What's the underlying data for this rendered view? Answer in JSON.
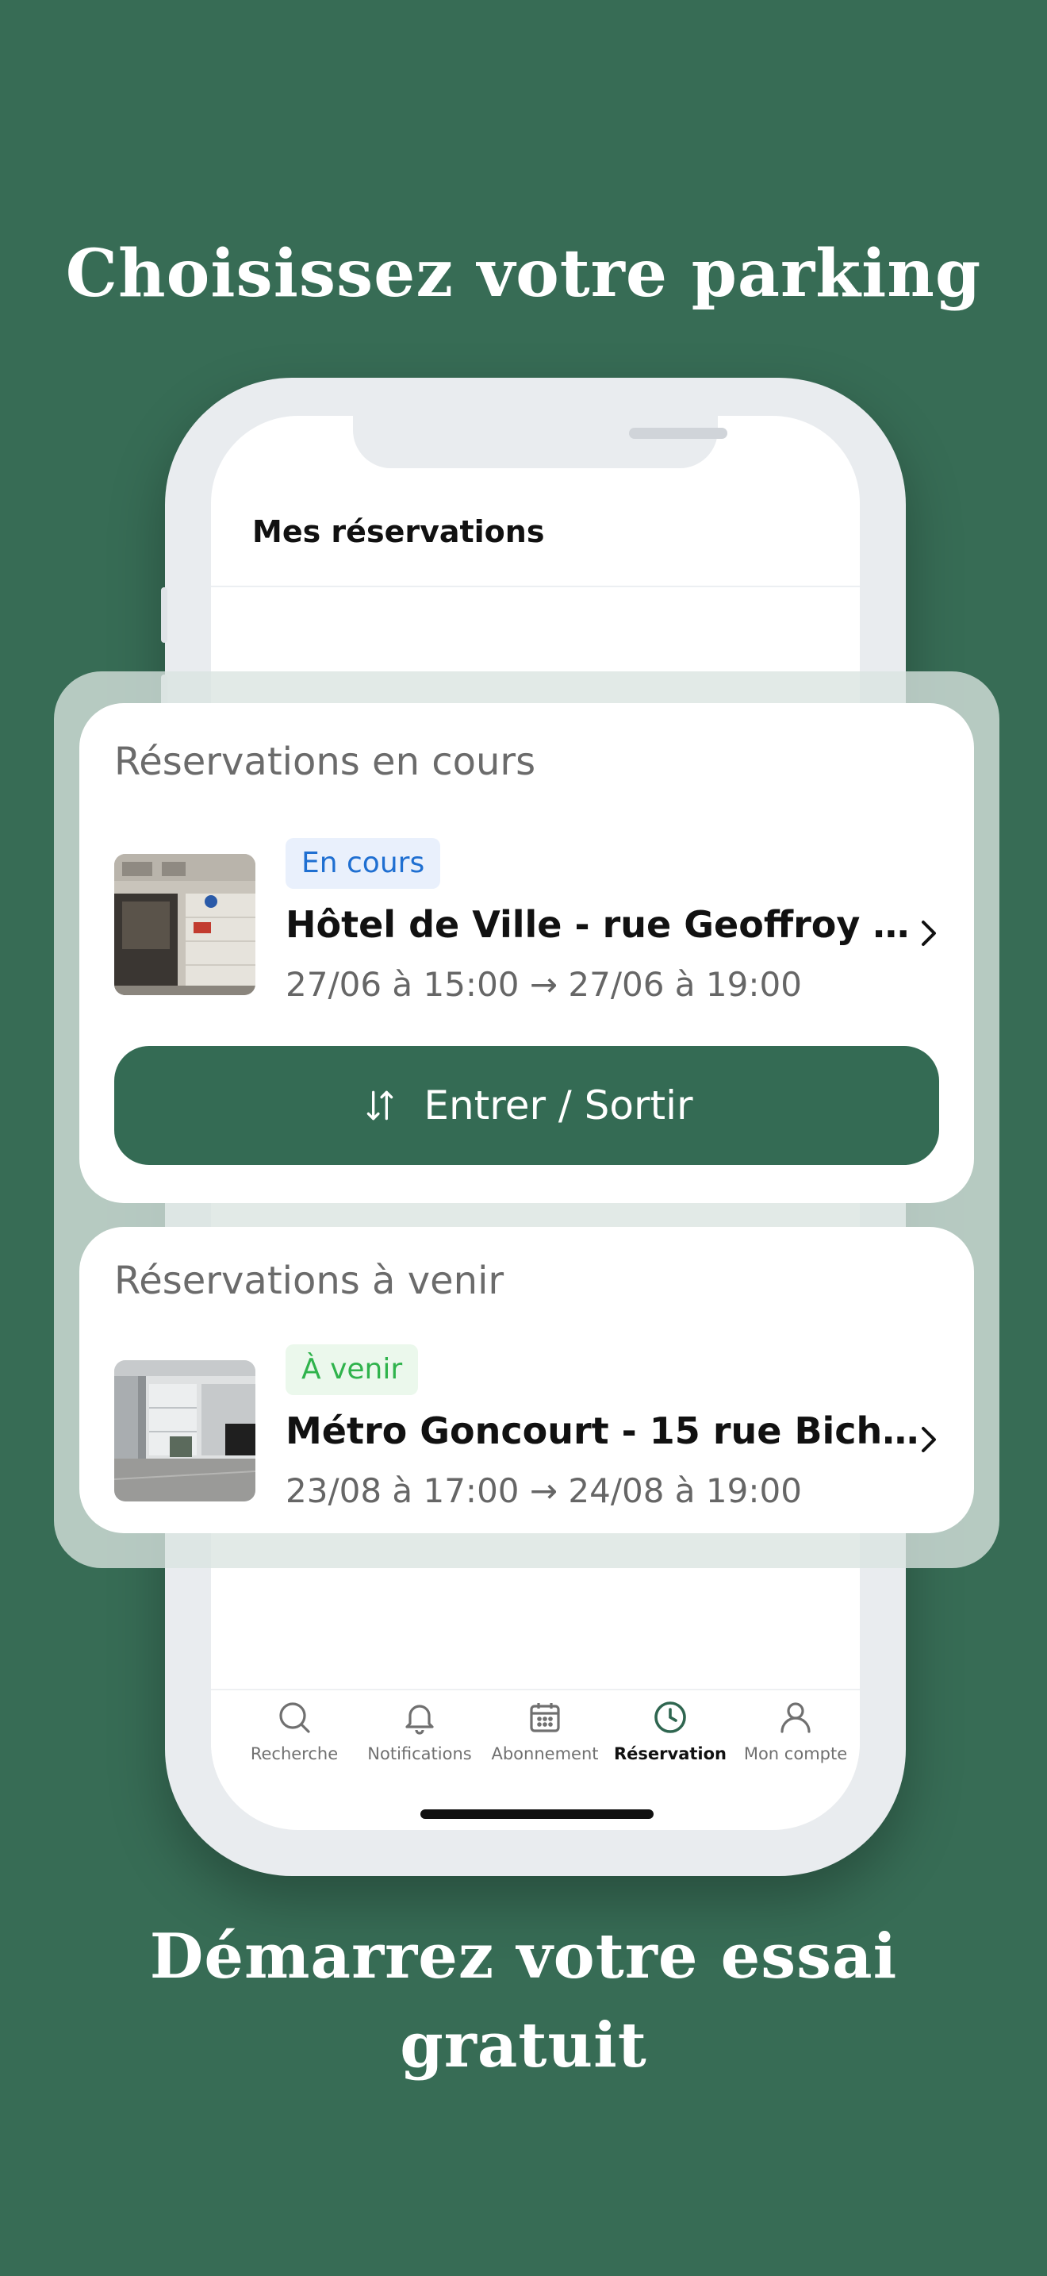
{
  "headline_top": "Choisissez votre parking",
  "headline_bottom_line1": "Démarrez votre essai",
  "headline_bottom_line2": "gratuit",
  "screen": {
    "title": "Mes réservations"
  },
  "current_section": {
    "title": "Réservations en cours",
    "reservation": {
      "status": "En cours",
      "name": "Hôtel de Ville - rue Geoffroy l'...",
      "dates": "27/06 à 15:00 → 27/06 à 19:00",
      "thumbnail_icon": "parking-entrance-photo"
    },
    "action_label": "Entrer / Sortir",
    "action_icon": "swap-arrows-icon"
  },
  "upcoming_section": {
    "title": "Réservations à venir",
    "reservation": {
      "status": "À venir",
      "name": "Métro Goncourt - 15 rue Bichat...",
      "dates": "23/08 à 17:00 → 24/08 à 19:00",
      "thumbnail_icon": "parking-building-photo"
    }
  },
  "tabbar": {
    "items": [
      {
        "label": "Recherche",
        "icon": "search-icon",
        "active": false
      },
      {
        "label": "Notifications",
        "icon": "bell-icon",
        "active": false
      },
      {
        "label": "Abonnement",
        "icon": "calendar-icon",
        "active": false
      },
      {
        "label": "Réservation",
        "icon": "clock-icon",
        "active": true
      },
      {
        "label": "Mon compte",
        "icon": "user-icon",
        "active": false
      }
    ]
  },
  "colors": {
    "background": "#376c55",
    "button": "#346b54",
    "badge_blue": "#1f6fd1",
    "badge_green": "#2fb34c"
  }
}
